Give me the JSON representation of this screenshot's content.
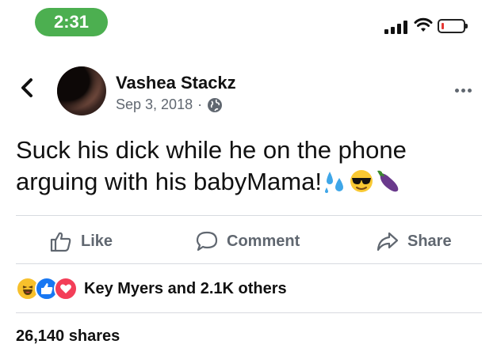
{
  "status_bar": {
    "time": "2:31",
    "signal_icon": "cellular-signal-icon",
    "wifi_icon": "wifi-icon",
    "battery_icon": "battery-low-icon",
    "battery_color": "#e53935",
    "time_bg": "#4caf50"
  },
  "post": {
    "author": "Vashea Stackz",
    "date": "Sep 3, 2018",
    "separator": "·",
    "privacy_icon": "globe-icon",
    "text": "Suck his dick while he on the phone arguing with his babyMama!",
    "emojis": [
      "sweat-droplets-emoji",
      "sunglasses-emoji",
      "eggplant-emoji"
    ]
  },
  "actions": {
    "like": "Like",
    "comment": "Comment",
    "share": "Share"
  },
  "reactions": {
    "icons": [
      "haha-reaction-icon",
      "like-reaction-icon",
      "love-reaction-icon"
    ],
    "summary": "Key Myers and 2.1K others"
  },
  "shares": "26,140 shares"
}
